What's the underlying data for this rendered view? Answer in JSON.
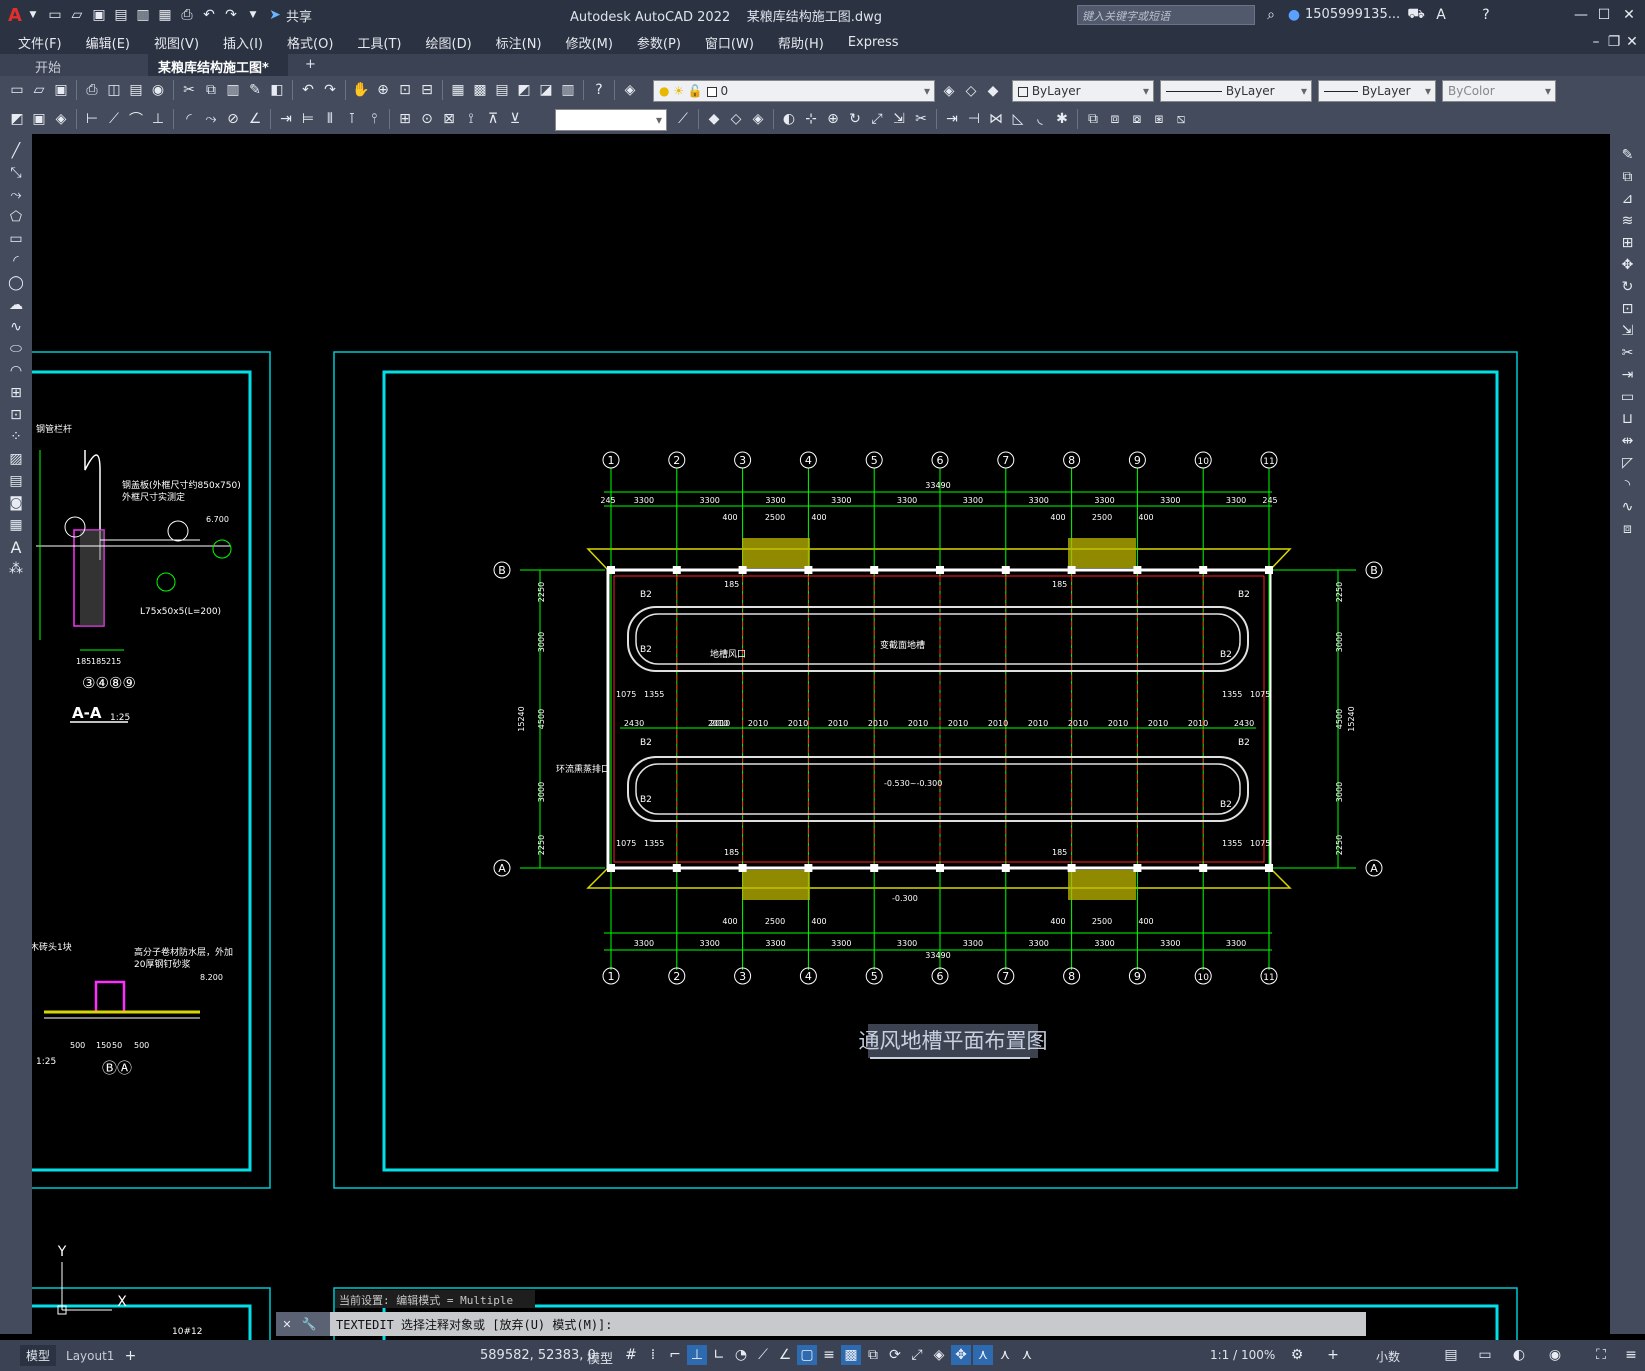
{
  "app": {
    "title": "Autodesk AutoCAD 2022",
    "file": "某粮库结构施工图.dwg",
    "share": "共享",
    "search_placeholder": "键入关键字或短语",
    "user": "1505999135...",
    "logo": "A"
  },
  "menus": [
    "文件(F)",
    "编辑(E)",
    "视图(V)",
    "插入(I)",
    "格式(O)",
    "工具(T)",
    "绘图(D)",
    "标注(N)",
    "修改(M)",
    "参数(P)",
    "窗口(W)",
    "帮助(H)",
    "Express"
  ],
  "tabs": {
    "start": "开始",
    "active": "某粮库结构施工图*",
    "add": "+"
  },
  "layer": {
    "name": "0"
  },
  "properties": {
    "color": "ByLayer",
    "linetype": "ByLayer",
    "lineweight": "ByLayer",
    "plotstyle": "ByColor"
  },
  "drawing": {
    "title": "通风地槽平面布置图",
    "grid_top": [
      "1",
      "2",
      "3",
      "4",
      "5",
      "6",
      "7",
      "8",
      "9",
      "10",
      "11"
    ],
    "grid_side": [
      "A",
      "B"
    ],
    "dim_total": "33490",
    "dim_span": "3300",
    "dim_edge": "245",
    "dim_sub": [
      "400",
      "2500",
      "400"
    ],
    "dim_width": "15240",
    "dim_mid": [
      "2430",
      "2010",
      "2430"
    ],
    "dim_vert": [
      "2250",
      "3000",
      "4500",
      "3000",
      "2250"
    ],
    "labels": {
      "b2": "B2",
      "vent": "地槽风口",
      "groove": "变截面地槽",
      "ventout": "环流熏蒸排口",
      "elev1": "-0.530~-0.300",
      "elev2": "-0.300",
      "d185": "185",
      "d1355": "1355",
      "d1075": "1075"
    },
    "left_detail": {
      "t1": "钢管栏杆",
      "t2": "钢盖板(外框尺寸约850x750)",
      "t3": "外框尺寸实测定",
      "t4": "L75x50x5(L=200)",
      "t5": "A-A",
      "scale": "1:25",
      "axes": "③④⑧⑨",
      "elev": "6.700",
      "elev2": "8.200",
      "t6": "高分子卷材防水层，外加",
      "t7": "20厚钢钉砂浆",
      "t8": "木砖头1块",
      "dims": [
        "185",
        "185",
        "215"
      ],
      "dims2": [
        "500",
        "150",
        "50",
        "500"
      ],
      "axes2": "ⒷⒶ",
      "scale2": "1:25",
      "t9": "10#12"
    }
  },
  "ucs": {
    "x": "X",
    "y": "Y"
  },
  "cmd": {
    "history": "当前设置: 编辑模式 = Multiple",
    "prompt": "TEXTEDIT 选择注释对象或 [放弃(U) 模式(M)]:"
  },
  "status": {
    "model_tab": "模型",
    "layout_tab": "Layout1",
    "coords": "589582, 52383, 0",
    "model": "模型",
    "scale": "1:1 / 100%",
    "units": "小数"
  }
}
